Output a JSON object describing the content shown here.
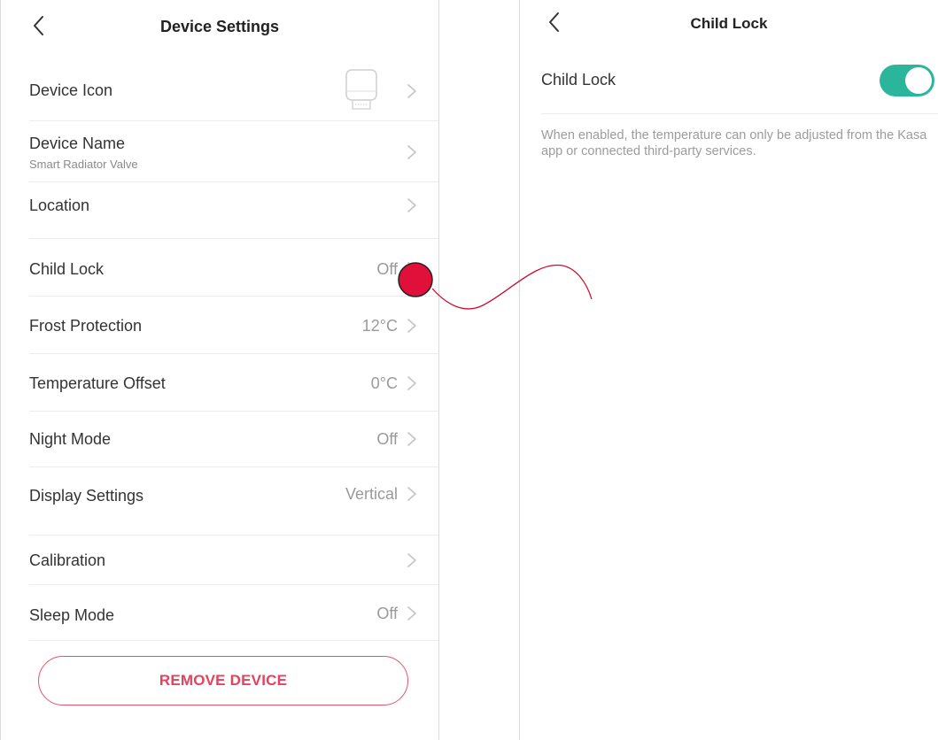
{
  "device_settings": {
    "title": "Device Settings",
    "rows": [
      {
        "label": "Device Icon",
        "sub": "",
        "value": "",
        "icon": "radiator-valve-icon"
      },
      {
        "label": "Device Name",
        "sub": "Smart Radiator Valve",
        "value": ""
      },
      {
        "label": "Location",
        "sub": "",
        "value": ""
      },
      {
        "label": "Child Lock",
        "sub": "",
        "value": "Off"
      },
      {
        "label": "Frost Protection",
        "sub": "",
        "value": "12°C"
      },
      {
        "label": "Temperature Offset",
        "sub": "",
        "value": "0°C"
      },
      {
        "label": "Night Mode",
        "sub": "",
        "value": "Off"
      },
      {
        "label": "Display Settings",
        "sub": "",
        "value": "Vertical"
      },
      {
        "label": "Calibration",
        "sub": "",
        "value": ""
      },
      {
        "label": "Sleep Mode",
        "sub": "",
        "value": "Off"
      }
    ],
    "remove_button": "REMOVE DEVICE"
  },
  "child_lock": {
    "title": "Child Lock",
    "toggle_label": "Child Lock",
    "toggle_on": true,
    "description": "When enabled, the temperature can only be adjusted from the Kasa app or connected third-party services."
  },
  "colors": {
    "accent_red": "#e2435e",
    "toggle_green": "#2bb59b",
    "annotation_dot": "#e0103a",
    "annotation_line": "#c8102e"
  }
}
